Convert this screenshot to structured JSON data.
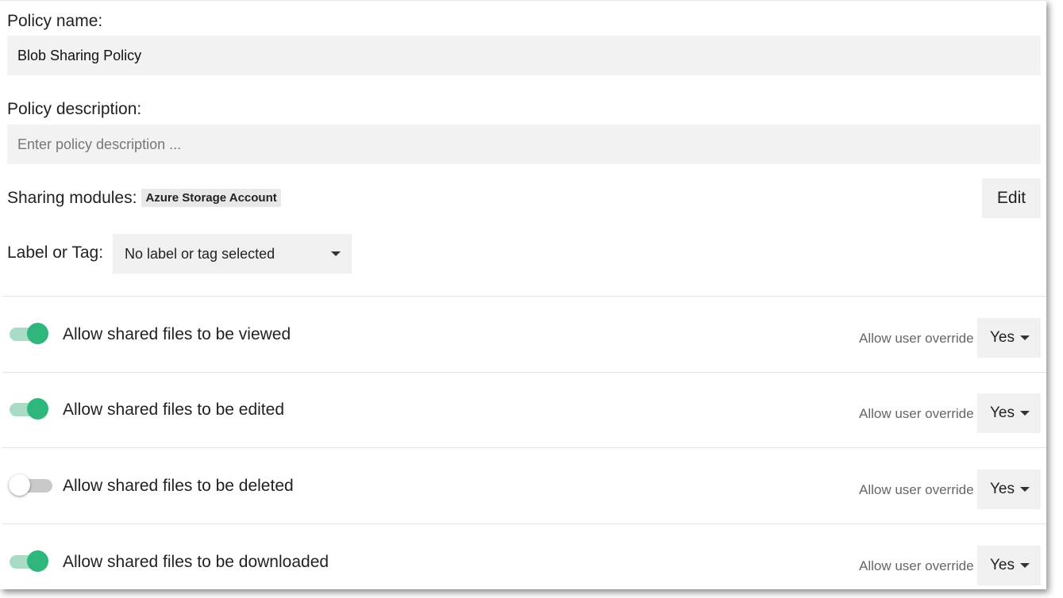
{
  "policy_name": {
    "label": "Policy name:",
    "value": "Blob Sharing Policy"
  },
  "policy_description": {
    "label": "Policy description:",
    "placeholder": "Enter policy description ..."
  },
  "sharing_modules": {
    "label": "Sharing modules:",
    "chip": "Azure Storage Account",
    "edit_label": "Edit"
  },
  "label_or_tag": {
    "label": "Label or Tag:",
    "selected": "No label or tag selected"
  },
  "permissions": [
    {
      "label": "Allow shared files to be viewed",
      "enabled": true,
      "override_label": "Allow user override",
      "override_value": "Yes"
    },
    {
      "label": "Allow shared files to be edited",
      "enabled": true,
      "override_label": "Allow user override",
      "override_value": "Yes"
    },
    {
      "label": "Allow shared files to be deleted",
      "enabled": false,
      "override_label": "Allow user override",
      "override_value": "Yes"
    },
    {
      "label": "Allow shared files to be downloaded",
      "enabled": true,
      "override_label": "Allow user override",
      "override_value": "Yes"
    }
  ],
  "colors": {
    "toggle_on": "#2eb67d",
    "toggle_on_track": "#a8dcc4",
    "toggle_off_track": "#c9c9c9",
    "field_bg": "#f2f2f2"
  }
}
